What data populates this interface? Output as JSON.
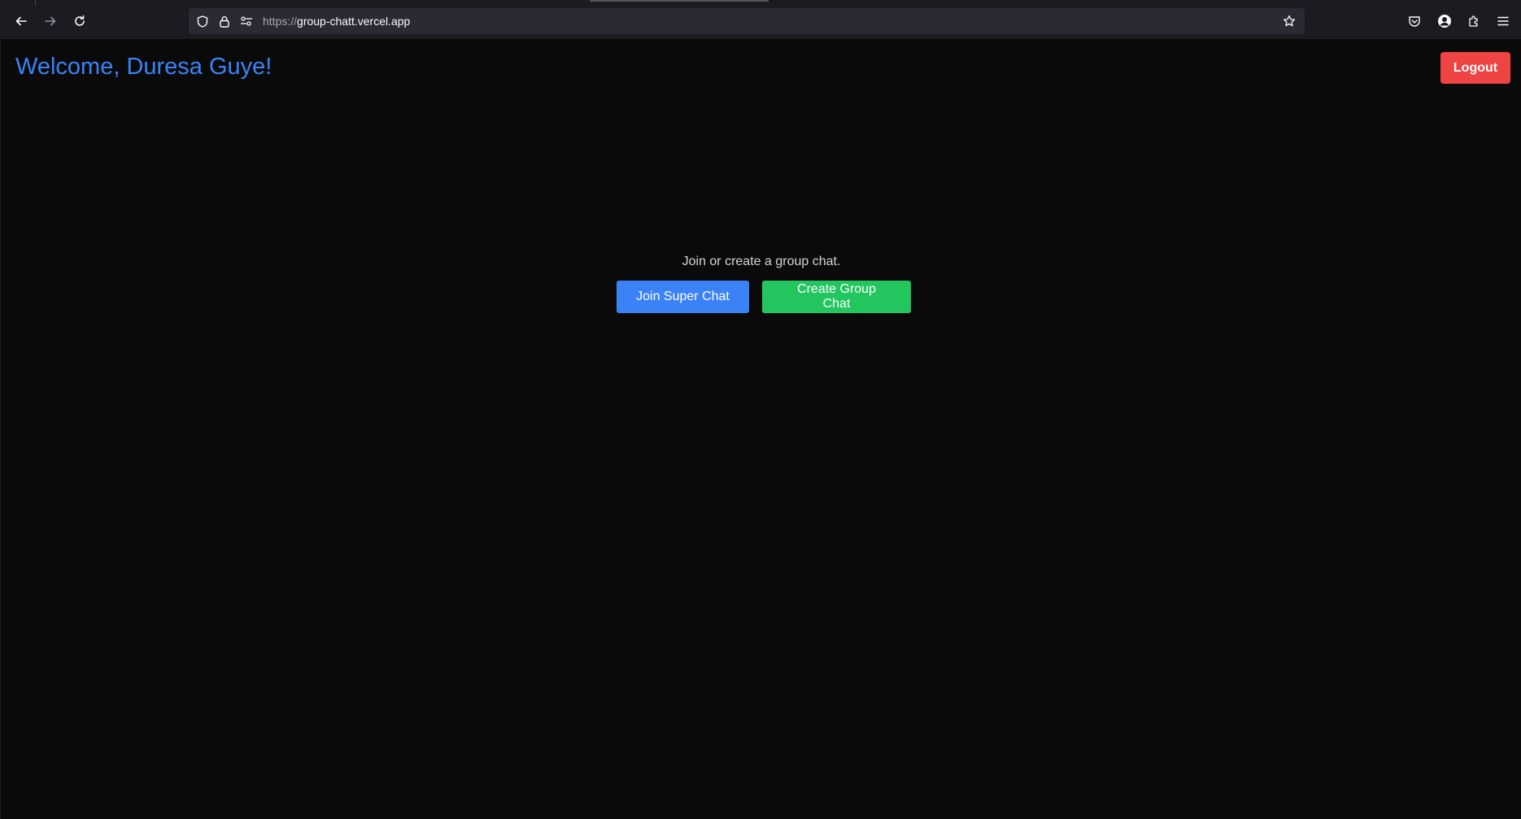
{
  "browser": {
    "url_scheme": "https://",
    "url_host": "group-chatt.vercel.app",
    "icons": {
      "back": "back-arrow-icon",
      "forward": "forward-arrow-icon",
      "reload": "reload-icon",
      "shield": "tracking-protection-shield-icon",
      "lock": "lock-icon",
      "permissions": "permissions-icon",
      "bookmark": "bookmark-star-icon",
      "pocket": "pocket-icon",
      "account": "account-icon",
      "extensions": "extensions-icon",
      "menu": "hamburger-menu-icon"
    }
  },
  "header": {
    "welcome_text": "Welcome, Duresa Guye!",
    "logout_label": "Logout"
  },
  "main": {
    "prompt": "Join or create a group chat.",
    "join_label": "Join Super Chat",
    "create_label": "Create Group Chat"
  },
  "colors": {
    "background": "#0a0a0a",
    "welcome": "#3b82f6",
    "logout": "#ef4444",
    "join": "#3b82f6",
    "create": "#22c55e"
  }
}
